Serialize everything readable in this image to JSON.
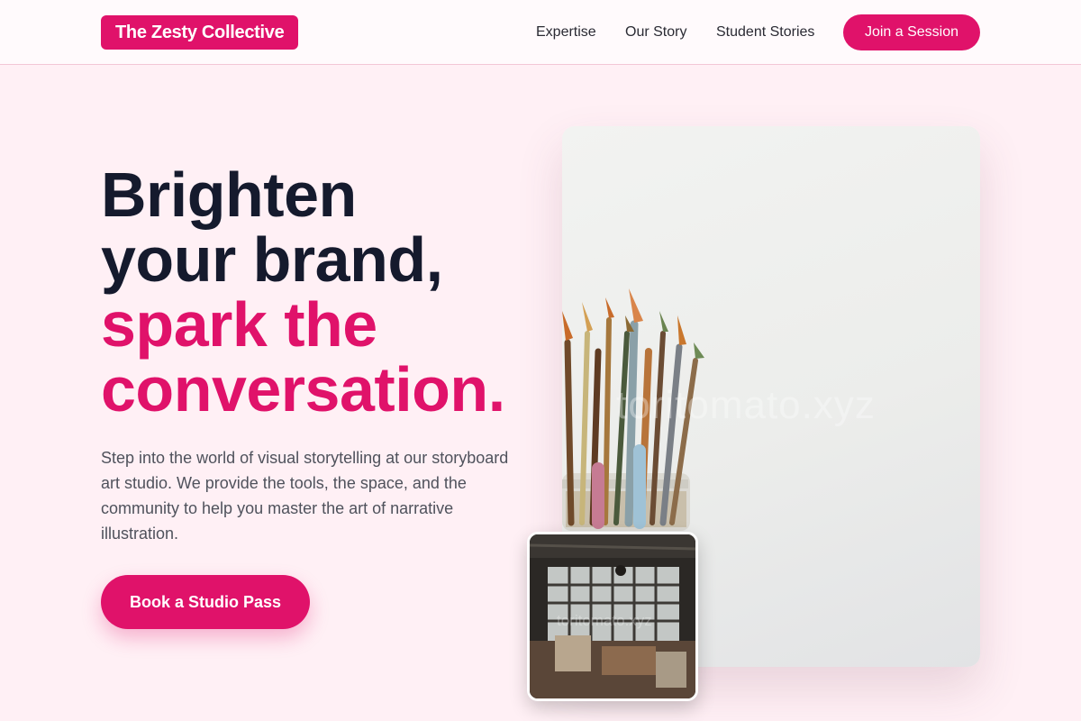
{
  "nav": {
    "logo": "The Zesty Collective",
    "links": [
      "Expertise",
      "Our Story",
      "Student Stories"
    ],
    "cta": "Join a Session"
  },
  "hero": {
    "headline_dark": [
      "Brighten",
      "your brand,"
    ],
    "headline_accent": [
      "spark the",
      "conversation."
    ],
    "description": "Step into the world of visual storytelling at our storyboard art studio. We provide the tools, the space, and the community to help you master the art of narrative illustration.",
    "button": "Book a Studio Pass"
  },
  "images": {
    "main_alt": "Jar of paint brushes",
    "main_watermark": "toritomato.xyz",
    "inset_alt": "Industrial art studio interior",
    "inset_watermark": "toritomato.xyz"
  },
  "colors": {
    "accent": "#e0126a",
    "page_background": "#fff0f5",
    "heading_dark": "#151a2d"
  }
}
